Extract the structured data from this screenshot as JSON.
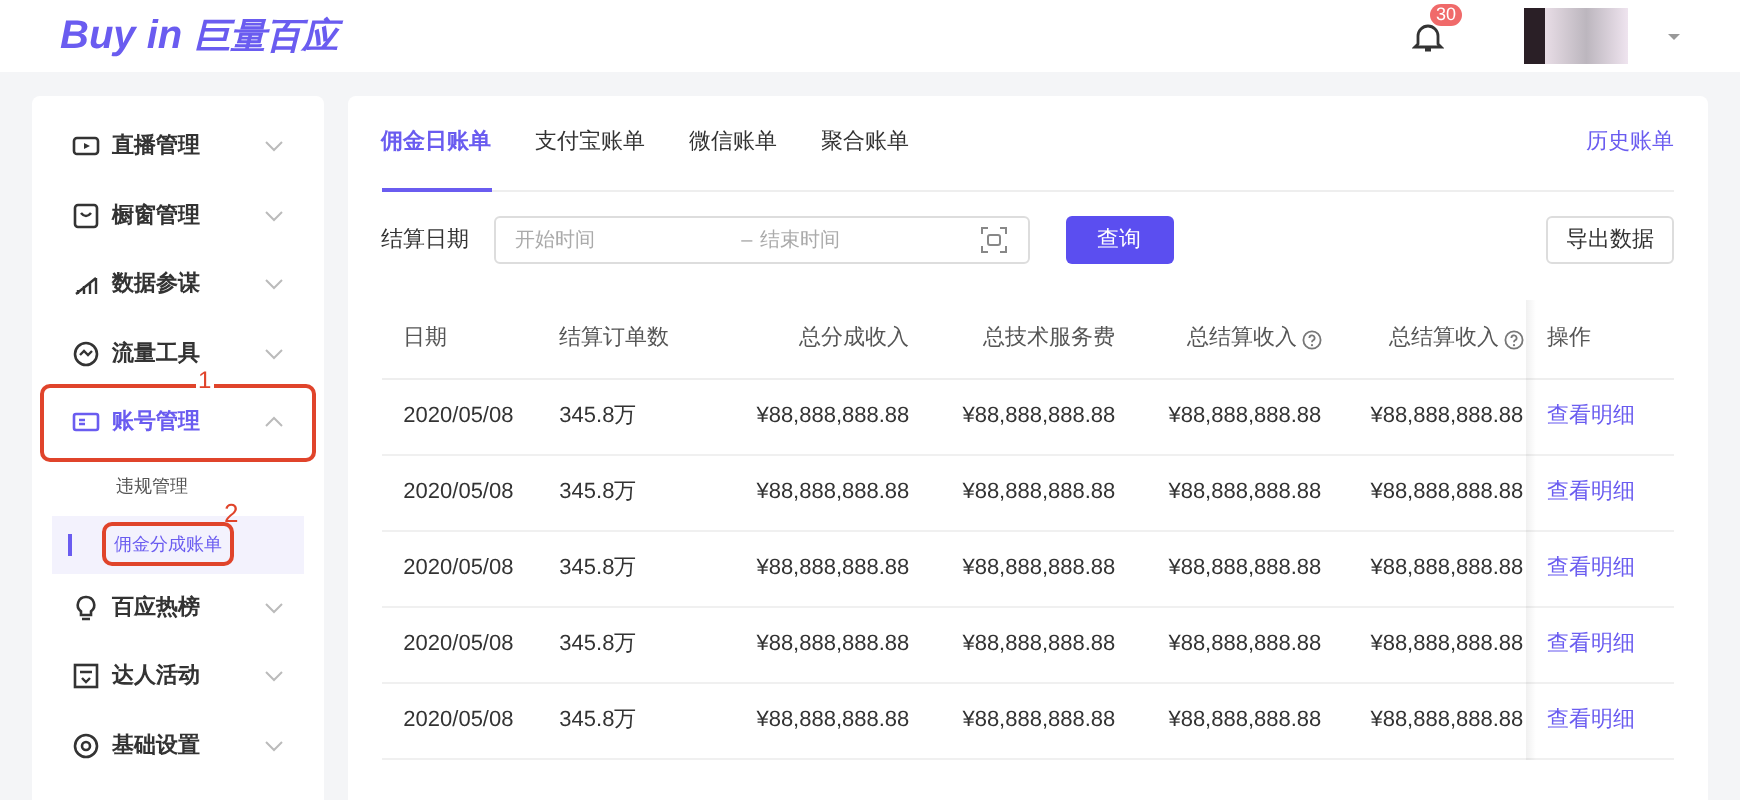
{
  "header": {
    "logo_latin": "Buy in",
    "logo_cjk": "巨量百应",
    "notifications": "30"
  },
  "sidebar": {
    "items": [
      {
        "label": "直播管理",
        "expanded": false,
        "selected": false
      },
      {
        "label": "橱窗管理",
        "expanded": false,
        "selected": false
      },
      {
        "label": "数据参谋",
        "expanded": false,
        "selected": false
      },
      {
        "label": "流量工具",
        "expanded": false,
        "selected": false
      },
      {
        "label": "账号管理",
        "expanded": true,
        "selected": true,
        "annotation": "1",
        "children": [
          {
            "label": "违规管理",
            "selected": false
          },
          {
            "label": "佣金分成账单",
            "selected": true,
            "annotation": "2"
          }
        ]
      },
      {
        "label": "百应热榜",
        "expanded": false,
        "selected": false
      },
      {
        "label": "达人活动",
        "expanded": false,
        "selected": false
      },
      {
        "label": "基础设置",
        "expanded": false,
        "selected": false
      }
    ]
  },
  "tabs": [
    {
      "label": "佣金日账单",
      "selected": true
    },
    {
      "label": "支付宝账单",
      "selected": false
    },
    {
      "label": "微信账单",
      "selected": false
    },
    {
      "label": "聚合账单",
      "selected": false
    }
  ],
  "history_link": "历史账单",
  "filter": {
    "label": "结算日期",
    "start_placeholder": "开始时间",
    "separator": "–",
    "end_placeholder": "结束时间",
    "query_button": "查询",
    "export_button": "导出数据"
  },
  "table": {
    "columns": [
      {
        "label": "日期",
        "help": false
      },
      {
        "label": "结算订单数",
        "help": false
      },
      {
        "label": "总分成收入",
        "help": false
      },
      {
        "label": "总技术服务费",
        "help": false
      },
      {
        "label": "总结算收入",
        "help": true
      },
      {
        "label": "总结算收入",
        "help": true
      },
      {
        "label": "操作",
        "help": false
      }
    ],
    "rows": [
      [
        "2020/05/08",
        "345.8万",
        "¥88,888,888.88",
        "¥88,888,888.88",
        "¥88,888,888.88",
        "¥88,888,888.88",
        "查看明细"
      ],
      [
        "2020/05/08",
        "345.8万",
        "¥88,888,888.88",
        "¥88,888,888.88",
        "¥88,888,888.88",
        "¥88,888,888.88",
        "查看明细"
      ],
      [
        "2020/05/08",
        "345.8万",
        "¥88,888,888.88",
        "¥88,888,888.88",
        "¥88,888,888.88",
        "¥88,888,888.88",
        "查看明细"
      ],
      [
        "2020/05/08",
        "345.8万",
        "¥88,888,888.88",
        "¥88,888,888.88",
        "¥88,888,888.88",
        "¥88,888,888.88",
        "查看明细"
      ],
      [
        "2020/05/08",
        "345.8万",
        "¥88,888,888.88",
        "¥88,888,888.88",
        "¥88,888,888.88",
        "¥88,888,888.88",
        "查看明细"
      ]
    ]
  }
}
